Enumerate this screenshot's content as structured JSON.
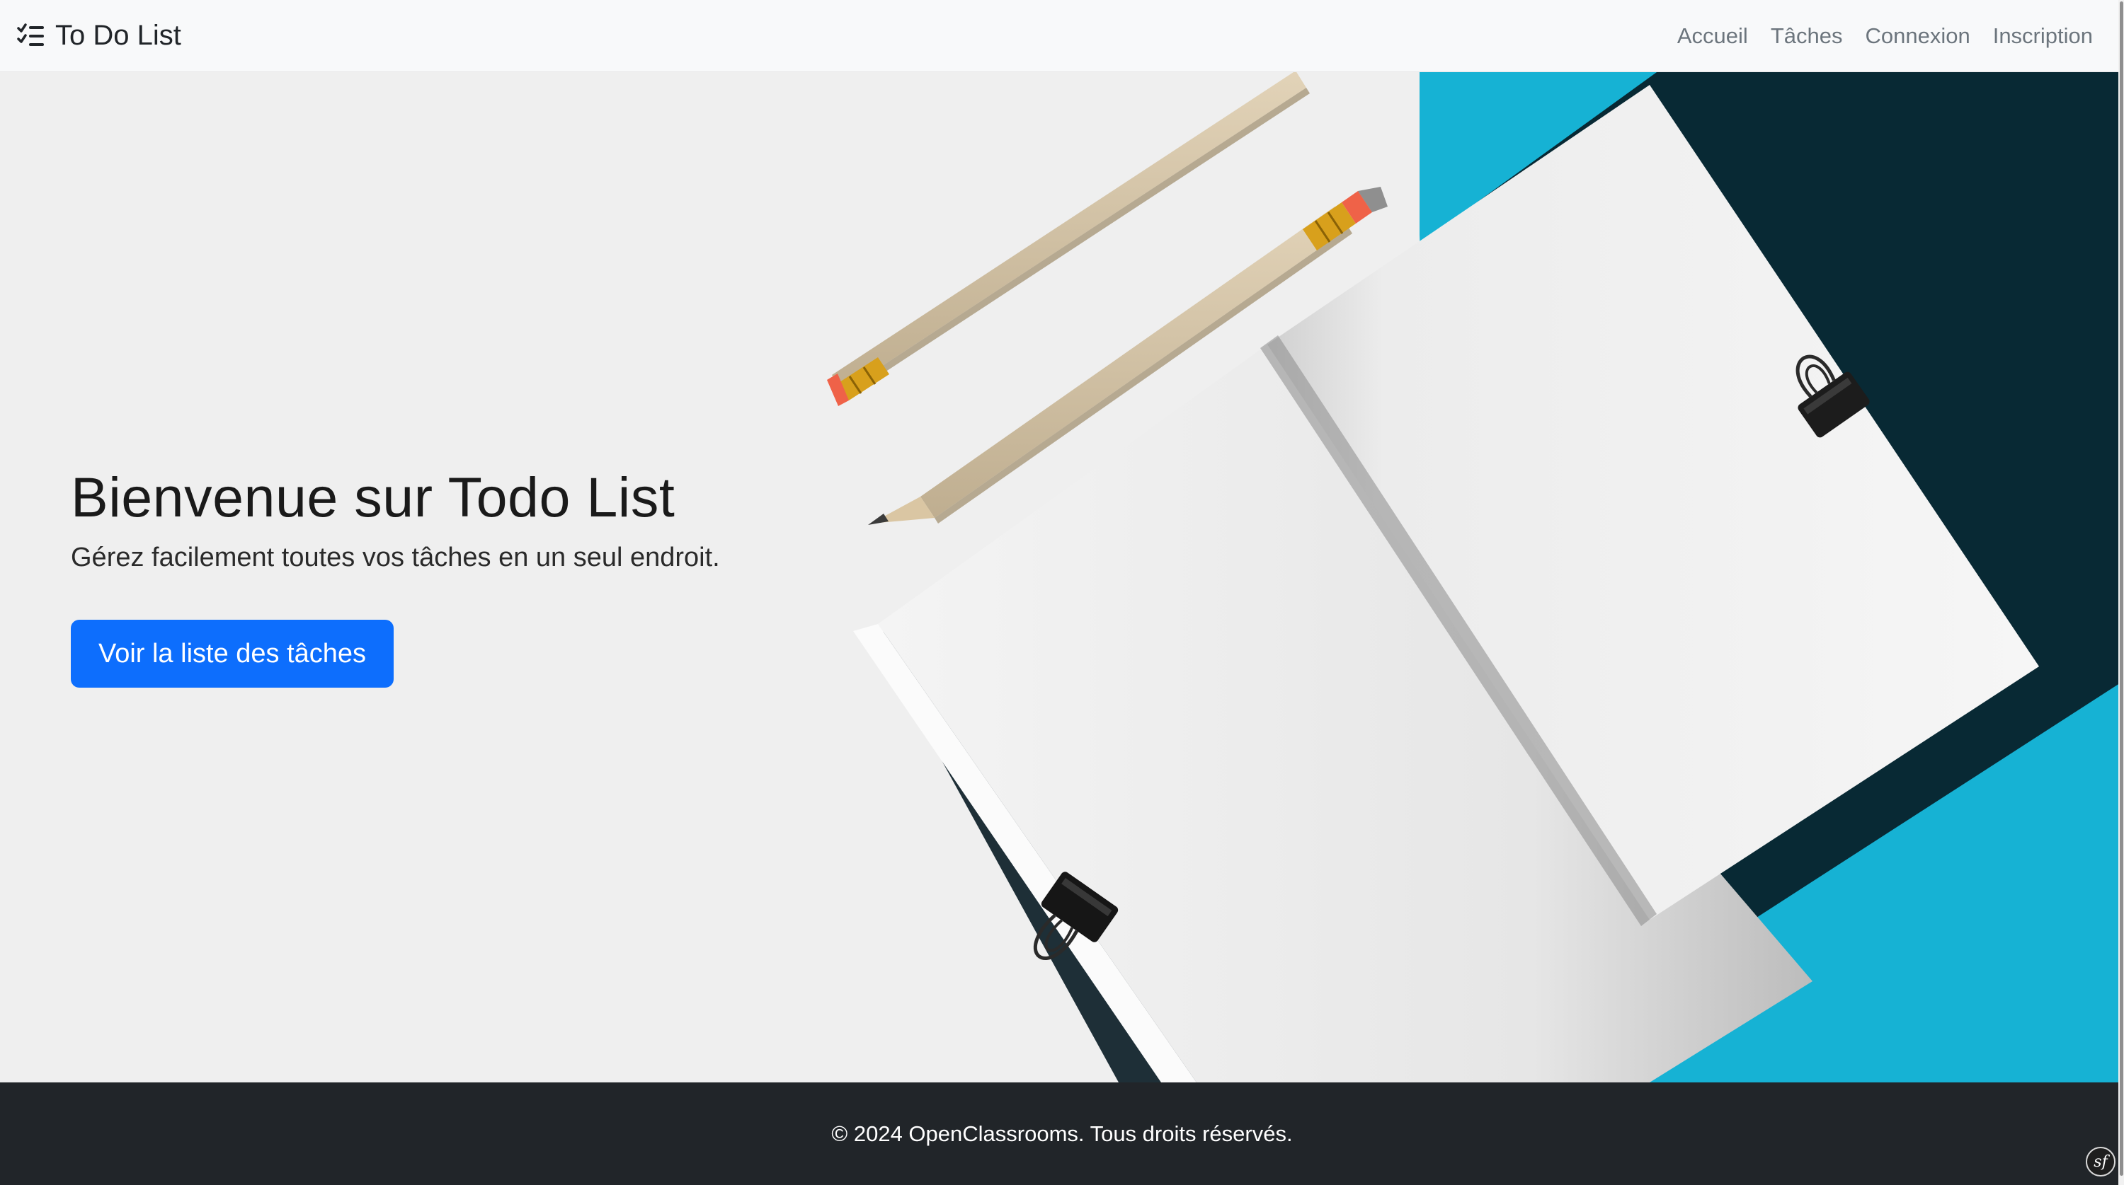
{
  "navbar": {
    "brand": "To Do List",
    "links": [
      "Accueil",
      "Tâches",
      "Connexion",
      "Inscription"
    ]
  },
  "hero": {
    "title": "Bienvenue sur Todo List",
    "subtitle": "Gérez facilement toutes vos tâches en un seul endroit.",
    "button_label": "Voir la liste des tâches"
  },
  "footer": {
    "text": "© 2024 OpenClassrooms. Tous droits réservés.",
    "badge": "sf"
  },
  "colors": {
    "navbar_bg": "#f8f9fa",
    "primary": "#0d6efd",
    "footer_bg": "#212529",
    "accent_backdrop": "#16b2d4"
  },
  "icons": {
    "brand": "list-check-icon",
    "badge": "symfony-icon"
  }
}
